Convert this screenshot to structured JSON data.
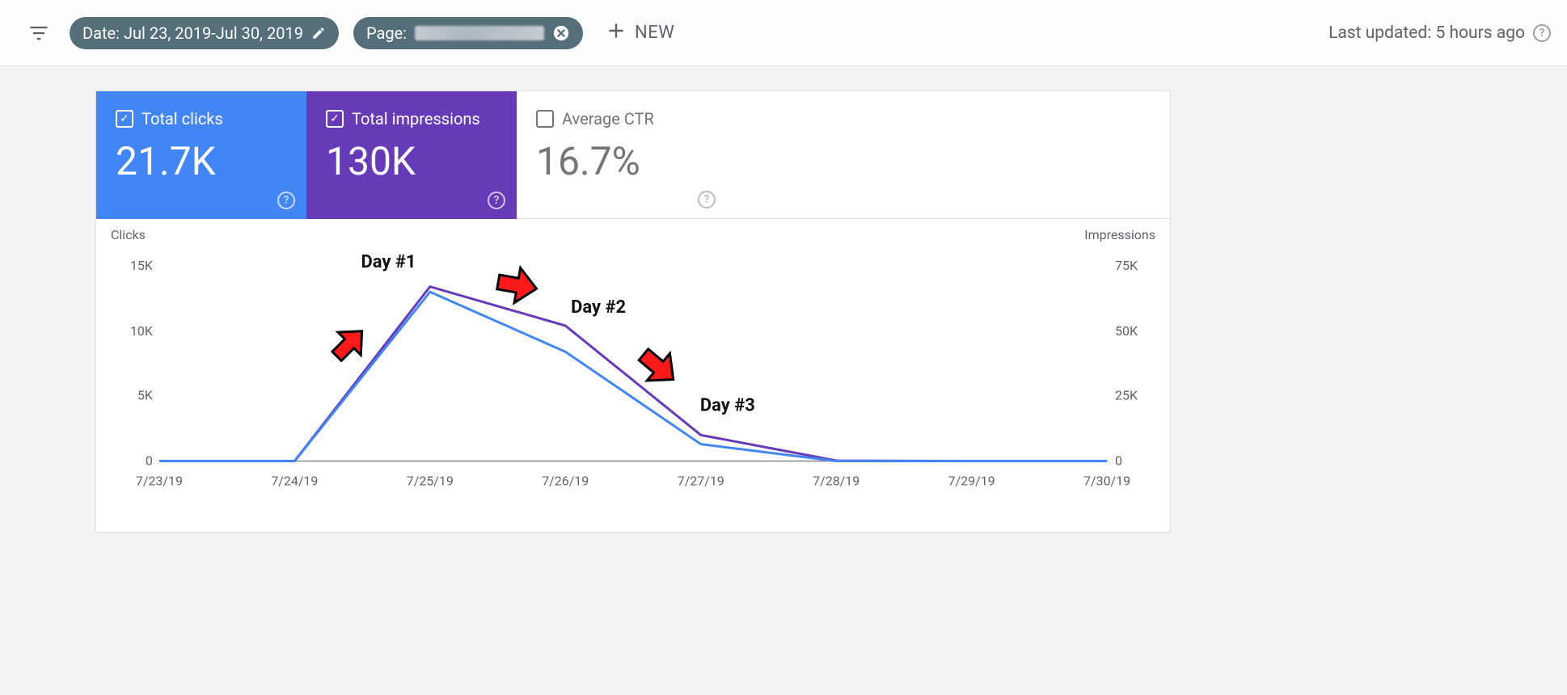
{
  "filters": {
    "date_chip_label": "Date: Jul 23, 2019-Jul 30, 2019",
    "page_chip_prefix": "Page:",
    "new_button_label": "NEW"
  },
  "status": {
    "last_updated": "Last updated: 5 hours ago"
  },
  "metrics": {
    "clicks": {
      "label": "Total clicks",
      "value": "21.7K",
      "checked": true
    },
    "impressions": {
      "label": "Total impressions",
      "value": "130K",
      "checked": true
    },
    "ctr": {
      "label": "Average CTR",
      "value": "16.7%",
      "checked": false
    }
  },
  "axes": {
    "left_title": "Clicks",
    "right_title": "Impressions",
    "left_ticks": [
      "15K",
      "10K",
      "5K",
      "0"
    ],
    "right_ticks": [
      "75K",
      "50K",
      "25K",
      "0"
    ],
    "x_ticks": [
      "7/23/19",
      "7/24/19",
      "7/25/19",
      "7/26/19",
      "7/27/19",
      "7/28/19",
      "7/29/19",
      "7/30/19"
    ]
  },
  "annotations": {
    "d1": "Day #1",
    "d2": "Day #2",
    "d3": "Day #3"
  },
  "colors": {
    "clicks": "#4285f4",
    "impressions": "#673ab7",
    "annotation_arrow": "#ff1a1a"
  },
  "chart_data": {
    "type": "line",
    "x": [
      "7/23/19",
      "7/24/19",
      "7/25/19",
      "7/26/19",
      "7/27/19",
      "7/28/19",
      "7/29/19",
      "7/30/19"
    ],
    "series": [
      {
        "name": "Clicks",
        "axis": "left",
        "color": "#4285f4",
        "values": [
          0,
          0,
          13000,
          8400,
          1300,
          0,
          0,
          0
        ]
      },
      {
        "name": "Impressions",
        "axis": "right",
        "color": "#673ab7",
        "values": [
          0,
          0,
          67000,
          52000,
          10000,
          200,
          0,
          0
        ]
      }
    ],
    "y_left": {
      "label": "Clicks",
      "range": [
        0,
        15000
      ],
      "ticks": [
        0,
        5000,
        10000,
        15000
      ]
    },
    "y_right": {
      "label": "Impressions",
      "range": [
        0,
        75000
      ],
      "ticks": [
        0,
        25000,
        50000,
        75000
      ]
    },
    "annotations": [
      {
        "text": "Day #1",
        "at_x": "7/25/19"
      },
      {
        "text": "Day #2",
        "at_x": "7/26/19"
      },
      {
        "text": "Day #3",
        "at_x": "7/27/19"
      }
    ]
  }
}
